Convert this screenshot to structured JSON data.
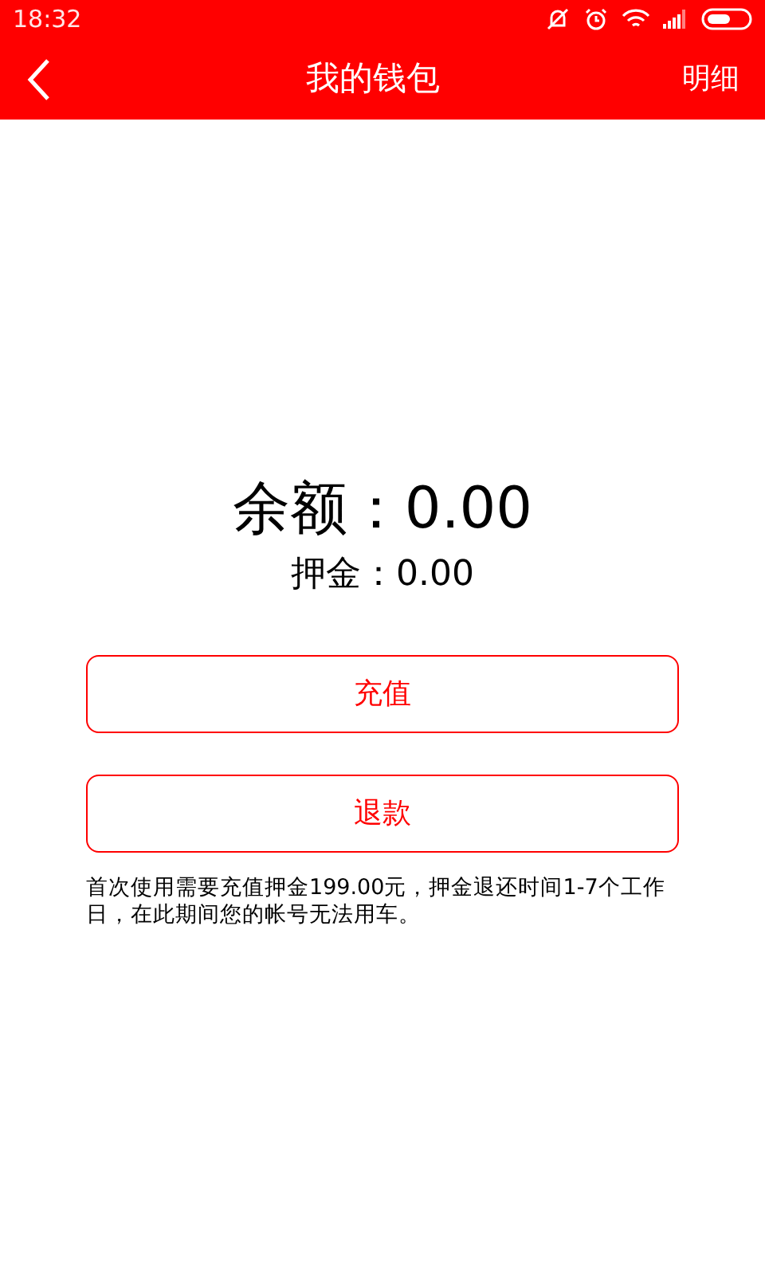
{
  "status_bar": {
    "time": "18:32"
  },
  "header": {
    "title": "我的钱包",
    "action": "明细"
  },
  "balance": {
    "label": "余额：",
    "value": "0.00"
  },
  "deposit": {
    "label": "押金：",
    "value": "0.00"
  },
  "buttons": [
    {
      "label": "充值"
    },
    {
      "label": "退款"
    }
  ],
  "notice": "首次使用需要充值押金199.00元，押金退还时间1-7个工作日，在此期间您的帐号无法用车。"
}
